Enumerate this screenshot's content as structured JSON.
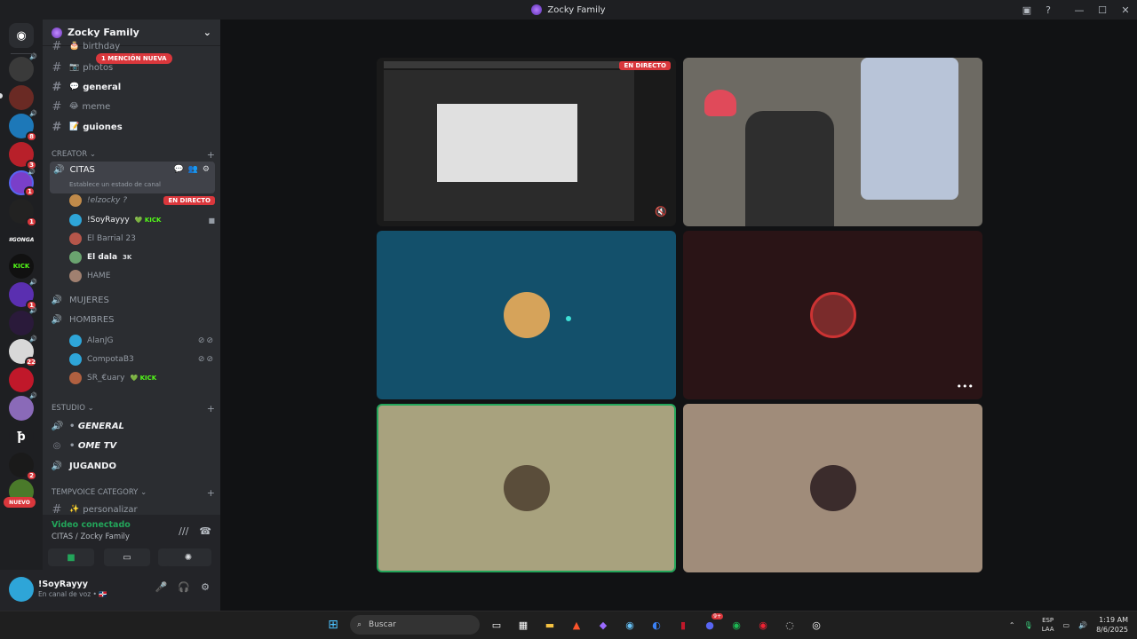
{
  "window": {
    "title": "Zocky Family"
  },
  "server": {
    "name": "Zocky Family",
    "mention_banner": "1 MENCIÓN NUEVA"
  },
  "guild_badges": [
    "8",
    "3",
    "1",
    "1",
    "1",
    "22",
    "2"
  ],
  "guild_labels": {
    "gonga": "#GONGA",
    "kick": "KICK",
    "nuevo": "NUEVO"
  },
  "text_channels": [
    {
      "label": "birthday",
      "emoji": "🎂",
      "bold": false
    },
    {
      "label": "photos",
      "emoji": "📷",
      "bold": false
    },
    {
      "label": "general",
      "emoji": "💬",
      "bold": true
    },
    {
      "label": "meme",
      "emoji": "😂",
      "bold": false
    },
    {
      "label": "guiones",
      "emoji": "📝",
      "bold": true
    }
  ],
  "categories": {
    "creator": "CREATOR",
    "estudio": "ESTUDIO",
    "tempvoice": "TEMPVOICE CATEGORY"
  },
  "voice_citas": {
    "name": "CITAS",
    "status": "Establece un estado de canal",
    "users": [
      {
        "name": "!elzocky ?",
        "badge": "EN DIRECTO",
        "color": "#c08a4a"
      },
      {
        "name": "!SoyRayyy",
        "tag": "💚 KICK",
        "color": "#2ea5d8"
      },
      {
        "name": "El Barrial 23",
        "color": "#b5564a"
      },
      {
        "name": "El dala",
        "tag": "3K",
        "color": "#6aa36f"
      },
      {
        "name": "HAME",
        "color": "#a08070"
      }
    ]
  },
  "voice_mujeres": "MUJERES",
  "voice_hombres": {
    "name": "HOMBRES",
    "users": [
      {
        "name": "AlanJG",
        "color": "#2ea5d8"
      },
      {
        "name": "CompotaB3",
        "color": "#2ea5d8"
      },
      {
        "name": "SR_€uary",
        "tag": "💚 KICK",
        "color": "#b06040"
      }
    ]
  },
  "estudio_channels": [
    "GENERAL",
    "OME TV",
    "JUGANDO"
  ],
  "tempvoice_channels": [
    {
      "label": "personalizar",
      "emoji": "✨"
    }
  ],
  "voice_panel": {
    "status": "Video conectado",
    "location": "CITAS / Zocky Family"
  },
  "user": {
    "name": "!SoyRayyy",
    "status": "En canal de voz • 🇩🇴"
  },
  "stream": {
    "live_label": "EN DIRECTO"
  },
  "tiles": [
    {
      "kind": "screen",
      "bg": "#2b2b2b"
    },
    {
      "kind": "camera",
      "bg": "#6d6a63"
    },
    {
      "kind": "avatar",
      "bg": "#13506b",
      "avatar_color": "#d6a35a"
    },
    {
      "kind": "avatar",
      "bg": "#2a1416",
      "avatar_color": "#7a2b2b"
    },
    {
      "kind": "avatar",
      "bg": "#a8a27e",
      "avatar_color": "#5a4d3a",
      "speaking": true
    },
    {
      "kind": "avatar",
      "bg": "#a08c7a",
      "avatar_color": "#3b2c2c"
    }
  ],
  "taskbar": {
    "search_placeholder": "Buscar",
    "lang_top": "ESP",
    "lang_bottom": "LAA",
    "time": "1:19 AM",
    "date": "8/6/2025",
    "discord_badge": "9+"
  },
  "colors": {
    "accent_red": "#da373c",
    "voice_green": "#23a55a",
    "kick_green": "#53fc18"
  }
}
